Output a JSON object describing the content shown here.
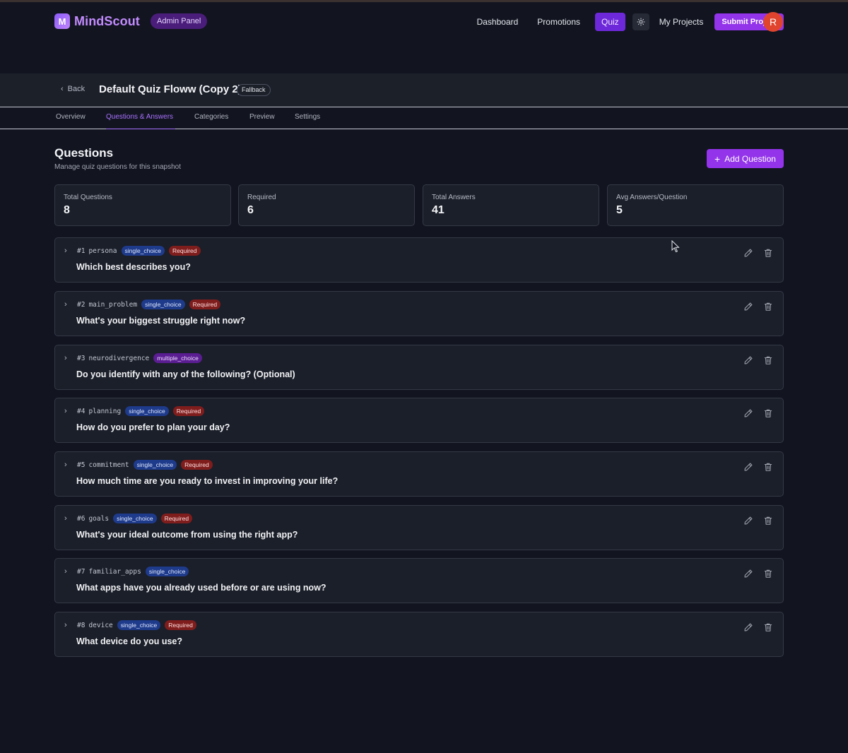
{
  "app": {
    "logo_letter": "M",
    "name": "MindScout",
    "badge": "Admin Panel"
  },
  "nav": {
    "items": [
      "Dashboard",
      "Promotions",
      "Quiz"
    ],
    "active": "Quiz",
    "theme_icon": "sun-icon",
    "projects": "My Projects",
    "submit": "Submit Project",
    "avatar": "R"
  },
  "flow": {
    "back": "Back",
    "title": "Default Quiz Floww (Copy 2)",
    "badge": "Fallback"
  },
  "tabs": [
    "Overview",
    "Questions & Answers",
    "Categories",
    "Preview",
    "Settings"
  ],
  "questions_header": {
    "title": "Questions",
    "subtitle": "Manage quiz questions for this snapshot",
    "add_button": "Add Question"
  },
  "stats": [
    {
      "label": "Total Questions",
      "value": "8"
    },
    {
      "label": "Required",
      "value": "6"
    },
    {
      "label": "Total Answers",
      "value": "41"
    },
    {
      "label": "Avg Answers/Question",
      "value": "5"
    }
  ],
  "questions": [
    {
      "id": "#1",
      "key": "persona",
      "type": "single_choice",
      "required": "Required",
      "text": "Which best describes you?"
    },
    {
      "id": "#2",
      "key": "main_problem",
      "type": "single_choice",
      "required": "Required",
      "text": "What's your biggest struggle right now?"
    },
    {
      "id": "#3",
      "key": "neurodivergence",
      "type": "multiple_choice",
      "required": "",
      "text": "Do you identify with any of the following? (Optional)"
    },
    {
      "id": "#4",
      "key": "planning",
      "type": "single_choice",
      "required": "Required",
      "text": "How do you prefer to plan your day?"
    },
    {
      "id": "#5",
      "key": "commitment",
      "type": "single_choice",
      "required": "Required",
      "text": "How much time are you ready to invest in improving your life?"
    },
    {
      "id": "#6",
      "key": "goals",
      "type": "single_choice",
      "required": "Required",
      "text": "What's your ideal outcome from using the right app?"
    },
    {
      "id": "#7",
      "key": "familiar_apps",
      "type": "single_choice",
      "required": "",
      "text": "What apps have you already used before or are using now?"
    },
    {
      "id": "#8",
      "key": "device",
      "type": "single_choice",
      "required": "Required",
      "text": "What device do you use?"
    }
  ],
  "colors": {
    "accent": "#9333ea",
    "background": "#121520",
    "card": "#1b1f29",
    "required": "#7f1d1d",
    "single_choice": "#1e3a8a",
    "multiple_choice": "#5b1d92"
  }
}
